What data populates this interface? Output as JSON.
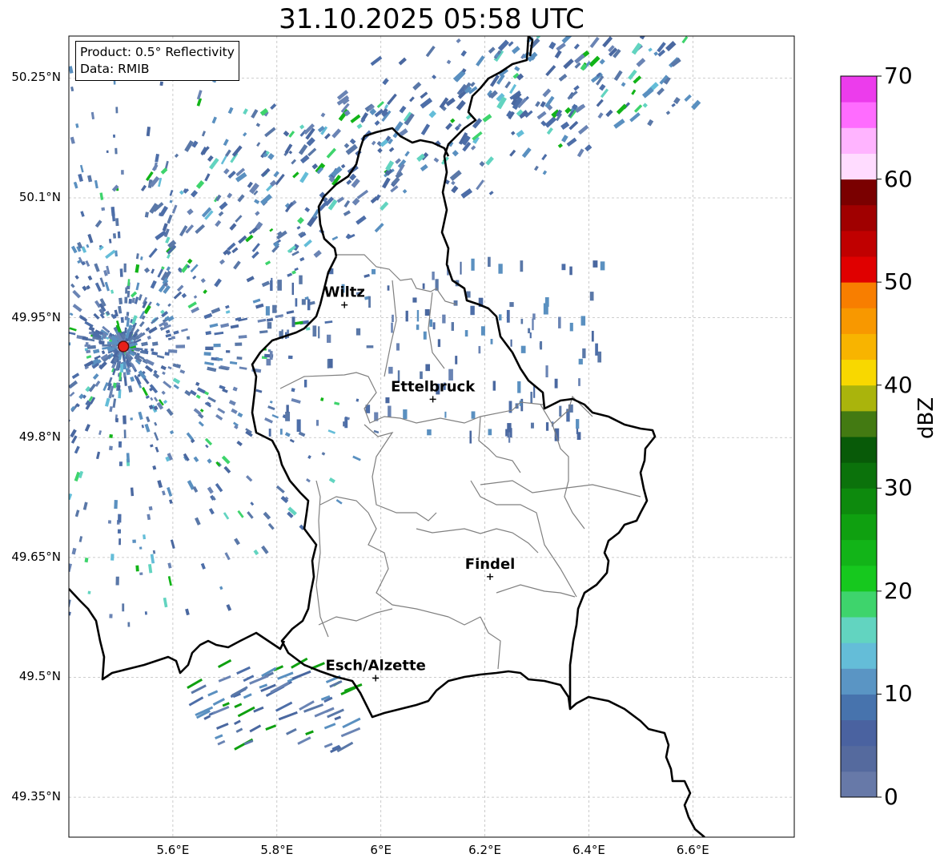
{
  "title": "31.10.2025 05:58 UTC",
  "info": {
    "product": "Product: 0.5° Reflectivity",
    "data": "Data: RMIB"
  },
  "lat_labels": [
    "50.25°N",
    "50.1°N",
    "49.95°N",
    "49.8°N",
    "49.65°N",
    "49.5°N",
    "49.35°N"
  ],
  "lon_labels": [
    "5.6°E",
    "5.8°E",
    "6°E",
    "6.2°E",
    "6.4°E",
    "6.6°E"
  ],
  "map_extent": {
    "lon": [
      5.4,
      6.795
    ],
    "lat": [
      49.3,
      50.3025
    ]
  },
  "radar_site": {
    "lon": 5.505,
    "lat": 49.914
  },
  "cities": [
    {
      "name": "Wiltz",
      "lon": 5.93,
      "lat": 49.966
    },
    {
      "name": "Ettelbruck",
      "lon": 6.1,
      "lat": 49.848
    },
    {
      "name": "Findel",
      "lon": 6.21,
      "lat": 49.626
    },
    {
      "name": "Esch/Alzette",
      "lon": 5.99,
      "lat": 49.499
    }
  ],
  "colorbar": {
    "unit": "dBZ",
    "tick_labels": [
      "0",
      "10",
      "20",
      "30",
      "40",
      "50",
      "60",
      "70"
    ],
    "min": 0,
    "max": 70,
    "step": 2.5,
    "colors": [
      "#6779a8",
      "#556a9e",
      "#4a62a0",
      "#4773ad",
      "#5a95c4",
      "#64bdd8",
      "#62d4c0",
      "#3ed46c",
      "#16c81e",
      "#12b418",
      "#0fa010",
      "#0d8a0d",
      "#0b720b",
      "#085a08",
      "#437a12",
      "#aab40c",
      "#f8d800",
      "#f8b400",
      "#f89800",
      "#f87e00",
      "#e00000",
      "#c00000",
      "#a00000",
      "#7a0000",
      "#ffdcff",
      "#ffb4ff",
      "#ff6cff",
      "#ec3cec"
    ]
  }
}
